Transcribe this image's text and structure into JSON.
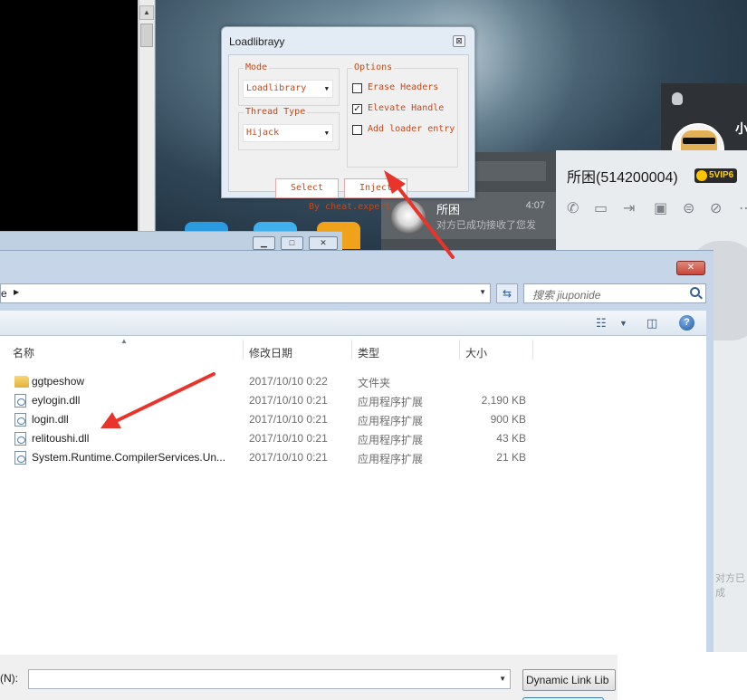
{
  "injector": {
    "title": "Loadlibrayy",
    "close_label": "⊠",
    "mode_label": "Mode",
    "mode_value": "Loadlibrary",
    "thread_label": "Thread Type",
    "thread_value": "Hijack",
    "options_label": "Options",
    "options": [
      {
        "label": "Erase Headers",
        "checked": false
      },
      {
        "label": "Elevate Handle",
        "checked": true
      },
      {
        "label": "Add loader entry",
        "checked": false
      }
    ],
    "select_label": "Select",
    "inject_label": "Inject",
    "credit": "By cheat.expert"
  },
  "qq": {
    "contact_name": "所困",
    "contact_time": "4:07",
    "contact_msg": "对方已成功接收了您发",
    "chat_title": "所困(514200004)",
    "vip_badge": "5VIP6",
    "user_initial": "小",
    "faded_text": "对方已成"
  },
  "console": {
    "scroll_up": "▲"
  },
  "small_window": {
    "min": "▁",
    "max": "□",
    "close": "✕"
  },
  "explorer": {
    "close_label": "✕",
    "address_text": "e",
    "address_arrow": "▶",
    "refresh_icon": "⇆",
    "search_placeholder": "搜索 jiuponide",
    "columns": {
      "name": "名称",
      "date": "修改日期",
      "type": "类型",
      "size": "大小"
    },
    "files": [
      {
        "name": "ggtpeshow",
        "date": "2017/10/10 0:22",
        "type": "文件夹",
        "size": "",
        "kind": "folder"
      },
      {
        "name": "eylogin.dll",
        "date": "2017/10/10 0:21",
        "type": "应用程序扩展",
        "size": "2,190 KB",
        "kind": "dll"
      },
      {
        "name": "login.dll",
        "date": "2017/10/10 0:21",
        "type": "应用程序扩展",
        "size": "900 KB",
        "kind": "dll"
      },
      {
        "name": "relitoushi.dll",
        "date": "2017/10/10 0:21",
        "type": "应用程序扩展",
        "size": "43 KB",
        "kind": "dll"
      },
      {
        "name": "System.Runtime.CompilerServices.Un...",
        "date": "2017/10/10 0:21",
        "type": "应用程序扩展",
        "size": "21 KB",
        "kind": "dll"
      }
    ],
    "filename_label": "(N):",
    "filename_value": "",
    "filter_label": "Dynamic Link Lib"
  },
  "colors": {
    "injector_text": "#c04a1c",
    "annotation_arrow": "#e8342a"
  }
}
